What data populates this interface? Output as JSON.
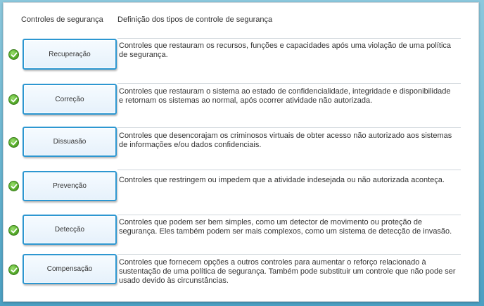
{
  "headers": {
    "left": "Controles de segurança",
    "right": "Definição dos tipos de controle de segurança"
  },
  "rows": [
    {
      "label": "Recuperação",
      "description": "Controles que restauram os recursos, funções e capacidades após uma violação de uma política de segurança."
    },
    {
      "label": "Correção",
      "description": "Controles que restauram o sistema ao estado de confidencialidade, integridade e disponibilidade e retornam os sistemas ao normal, após ocorrer atividade não autorizada."
    },
    {
      "label": "Dissuasão",
      "description": "Controles que desencorajam os criminosos virtuais de obter acesso não autorizado aos sistemas de informações e/ou dados confidenciais."
    },
    {
      "label": "Prevenção",
      "description": "Controles que restringem ou impedem que a atividade indesejada ou não autorizada aconteça."
    },
    {
      "label": "Detecção",
      "description": "Controles que podem ser bem simples, como um detector de movimento ou proteção de segurança. Eles também podem ser mais complexos, como um sistema de detecção de invasão."
    },
    {
      "label": "Compensação",
      "description": "Controles que fornecem opções a outros controles para aumentar o reforço relacionado à sustentação de uma política de segurança. Também pode substituir um controle que não pode ser usado devido às circunstâncias."
    }
  ],
  "colors": {
    "tile_border": "#2d97d1",
    "check_green": "#5bb02e",
    "background": "#6fb7d2"
  },
  "icons": {
    "status": "check-circle-icon"
  }
}
